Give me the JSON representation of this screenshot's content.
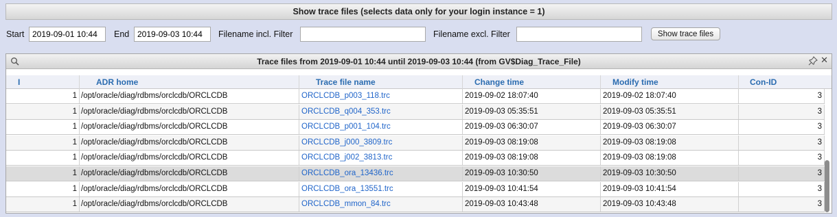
{
  "header": {
    "title": "Show trace files (selects data only for your login instance = 1)"
  },
  "filters": {
    "start_label": "Start",
    "start_value": "2019-09-01 10:44",
    "end_label": "End",
    "end_value": "2019-09-03 10:44",
    "incl_label": "Filename incl. Filter",
    "incl_value": "",
    "excl_label": "Filename excl. Filter",
    "excl_value": "",
    "button_label": "Show trace files"
  },
  "grid": {
    "title": "Trace files from 2019-09-01 10:44 until 2019-09-03 10:44 (from GV$Diag_Trace_File)",
    "columns": [
      "I",
      "ADR home",
      "Trace file name",
      "Change time",
      "Modify time",
      "Con-ID"
    ],
    "rows": [
      [
        "1",
        "/opt/oracle/diag/rdbms/orclcdb/ORCLCDB",
        "ORCLCDB_p003_118.trc",
        "2019-09-02 18:07:40",
        "2019-09-02 18:07:40",
        "3"
      ],
      [
        "1",
        "/opt/oracle/diag/rdbms/orclcdb/ORCLCDB",
        "ORCLCDB_q004_353.trc",
        "2019-09-03 05:35:51",
        "2019-09-03 05:35:51",
        "3"
      ],
      [
        "1",
        "/opt/oracle/diag/rdbms/orclcdb/ORCLCDB",
        "ORCLCDB_p001_104.trc",
        "2019-09-03 06:30:07",
        "2019-09-03 06:30:07",
        "3"
      ],
      [
        "1",
        "/opt/oracle/diag/rdbms/orclcdb/ORCLCDB",
        "ORCLCDB_j000_3809.trc",
        "2019-09-03 08:19:08",
        "2019-09-03 08:19:08",
        "3"
      ],
      [
        "1",
        "/opt/oracle/diag/rdbms/orclcdb/ORCLCDB",
        "ORCLCDB_j002_3813.trc",
        "2019-09-03 08:19:08",
        "2019-09-03 08:19:08",
        "3"
      ],
      [
        "1",
        "/opt/oracle/diag/rdbms/orclcdb/ORCLCDB",
        "ORCLCDB_ora_13436.trc",
        "2019-09-03 10:30:50",
        "2019-09-03 10:30:50",
        "3"
      ],
      [
        "1",
        "/opt/oracle/diag/rdbms/orclcdb/ORCLCDB",
        "ORCLCDB_ora_13551.trc",
        "2019-09-03 10:41:54",
        "2019-09-03 10:41:54",
        "3"
      ],
      [
        "1",
        "/opt/oracle/diag/rdbms/orclcdb/ORCLCDB",
        "ORCLCDB_mmon_84.trc",
        "2019-09-03 10:43:48",
        "2019-09-03 10:43:48",
        "3"
      ]
    ],
    "selected_row": 5
  },
  "icons": {
    "search": "magnifier-icon",
    "pin": "pin-icon",
    "close": "close-icon"
  }
}
